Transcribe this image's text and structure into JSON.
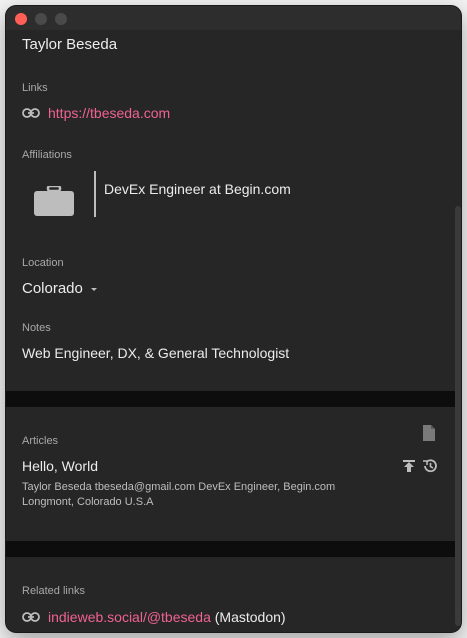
{
  "window": {
    "traffic_lights": [
      "close",
      "minimize",
      "maximize"
    ]
  },
  "profile": {
    "name": "Taylor Beseda",
    "links_label": "Links",
    "link_url": "https://tbeseda.com",
    "affiliations_label": "Affiliations",
    "affiliation": "DevEx Engineer at Begin.com",
    "location_label": "Location",
    "location_value": "Colorado",
    "notes_label": "Notes",
    "notes_value": "Web Engineer, DX, & General Technologist"
  },
  "articles": {
    "label": "Articles",
    "title": "Hello, World",
    "line1": "Taylor Beseda tbeseda@gmail.com DevEx Engineer, Begin.com",
    "line2": "Longmont, Colorado U.S.A"
  },
  "related": {
    "label": "Related links",
    "link": "indieweb.social/@tbeseda",
    "suffix": " (Mastodon)"
  },
  "colors": {
    "accent": "#f06292",
    "bg": "#262627",
    "separator": "#0d0d0d"
  },
  "icons": [
    "link-icon",
    "briefcase-icon",
    "dropdown-caret-icon",
    "document-icon",
    "upload-icon",
    "history-icon"
  ]
}
